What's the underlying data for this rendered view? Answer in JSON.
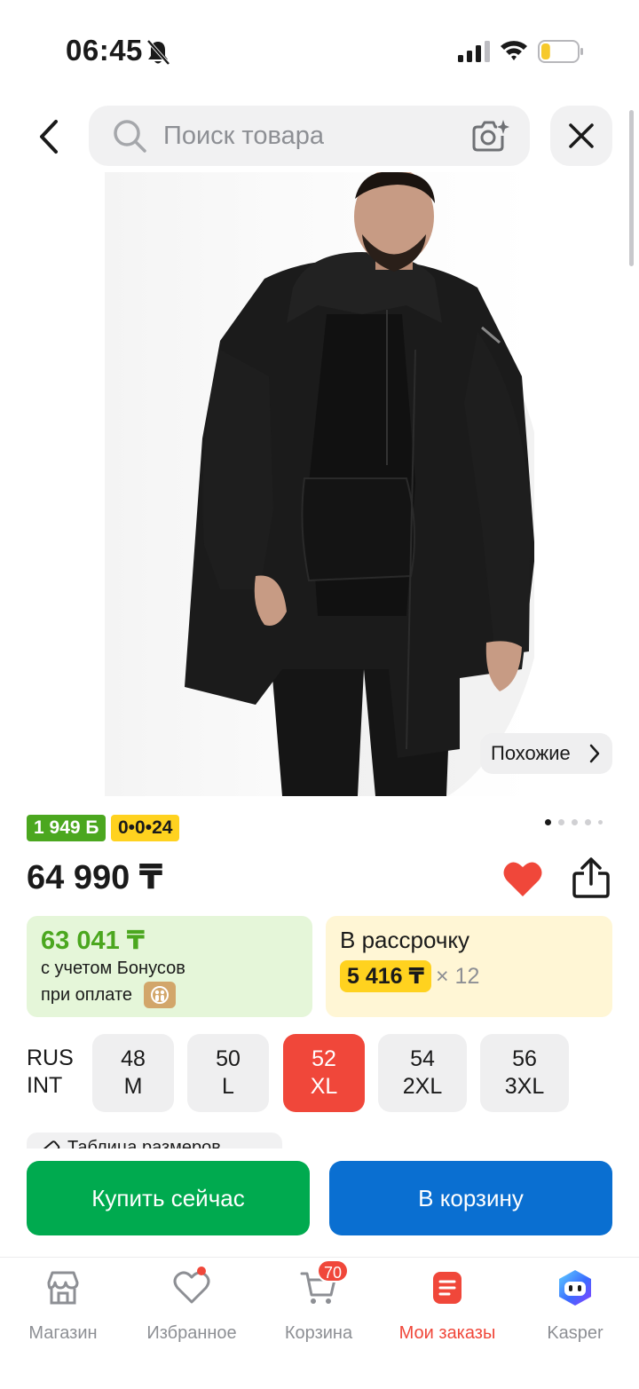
{
  "status_bar": {
    "time": "06:45",
    "icons": [
      "bell-off-icon",
      "signal-icon",
      "wifi-icon",
      "battery-icon"
    ],
    "battery_level": 0.25
  },
  "header": {
    "search_placeholder": "Поиск товара",
    "icons": [
      "back-arrow-icon",
      "search-icon",
      "camera-icon",
      "close-icon"
    ]
  },
  "product": {
    "image_alt": "",
    "similar_label": "Похожие",
    "bonus_badge": "1 949 Б",
    "installment_badge": "0•0•24",
    "gallery_pages": 5,
    "gallery_current": 1,
    "price": "64 990 ₸",
    "favorited": true
  },
  "offers": {
    "bonus_amount": "63 041 ₸",
    "bonus_note_1": "с учетом Бонусов",
    "bonus_note_2": "при оплате",
    "installment_title": "В рассрочку",
    "installment_monthly": "5 416 ₸",
    "installment_months": "× 12"
  },
  "sizes": {
    "label_rus": "RUS",
    "label_int": "INT",
    "options": [
      {
        "rus": "48",
        "int": "M",
        "selected": false
      },
      {
        "rus": "50",
        "int": "L",
        "selected": false
      },
      {
        "rus": "52",
        "int": "XL",
        "selected": true
      },
      {
        "rus": "54",
        "int": "2XL",
        "selected": false
      },
      {
        "rus": "56",
        "int": "3XL",
        "selected": false
      }
    ],
    "size_table_link": "Таблица размеров"
  },
  "actions": {
    "buy_now": "Купить сейчас",
    "add_to_cart": "В корзину"
  },
  "bottom_nav": {
    "items": [
      {
        "label": "Магазин",
        "icon": "shop-icon",
        "active": false
      },
      {
        "label": "Избранное",
        "icon": "heart-outline-icon",
        "active": false
      },
      {
        "label": "Корзина",
        "icon": "cart-icon",
        "active": false,
        "badge": "70"
      },
      {
        "label": "Мои заказы",
        "icon": "orders-icon",
        "active": true
      },
      {
        "label": "Kasper",
        "icon": "kasper-assistant-icon",
        "active": false
      }
    ]
  },
  "colors": {
    "accent_red": "#f0473a",
    "bonus_green": "#4ba71f",
    "installment_yellow": "#ffd21f",
    "buy_green": "#00aa4f",
    "cart_blue": "#0a6fd1"
  }
}
